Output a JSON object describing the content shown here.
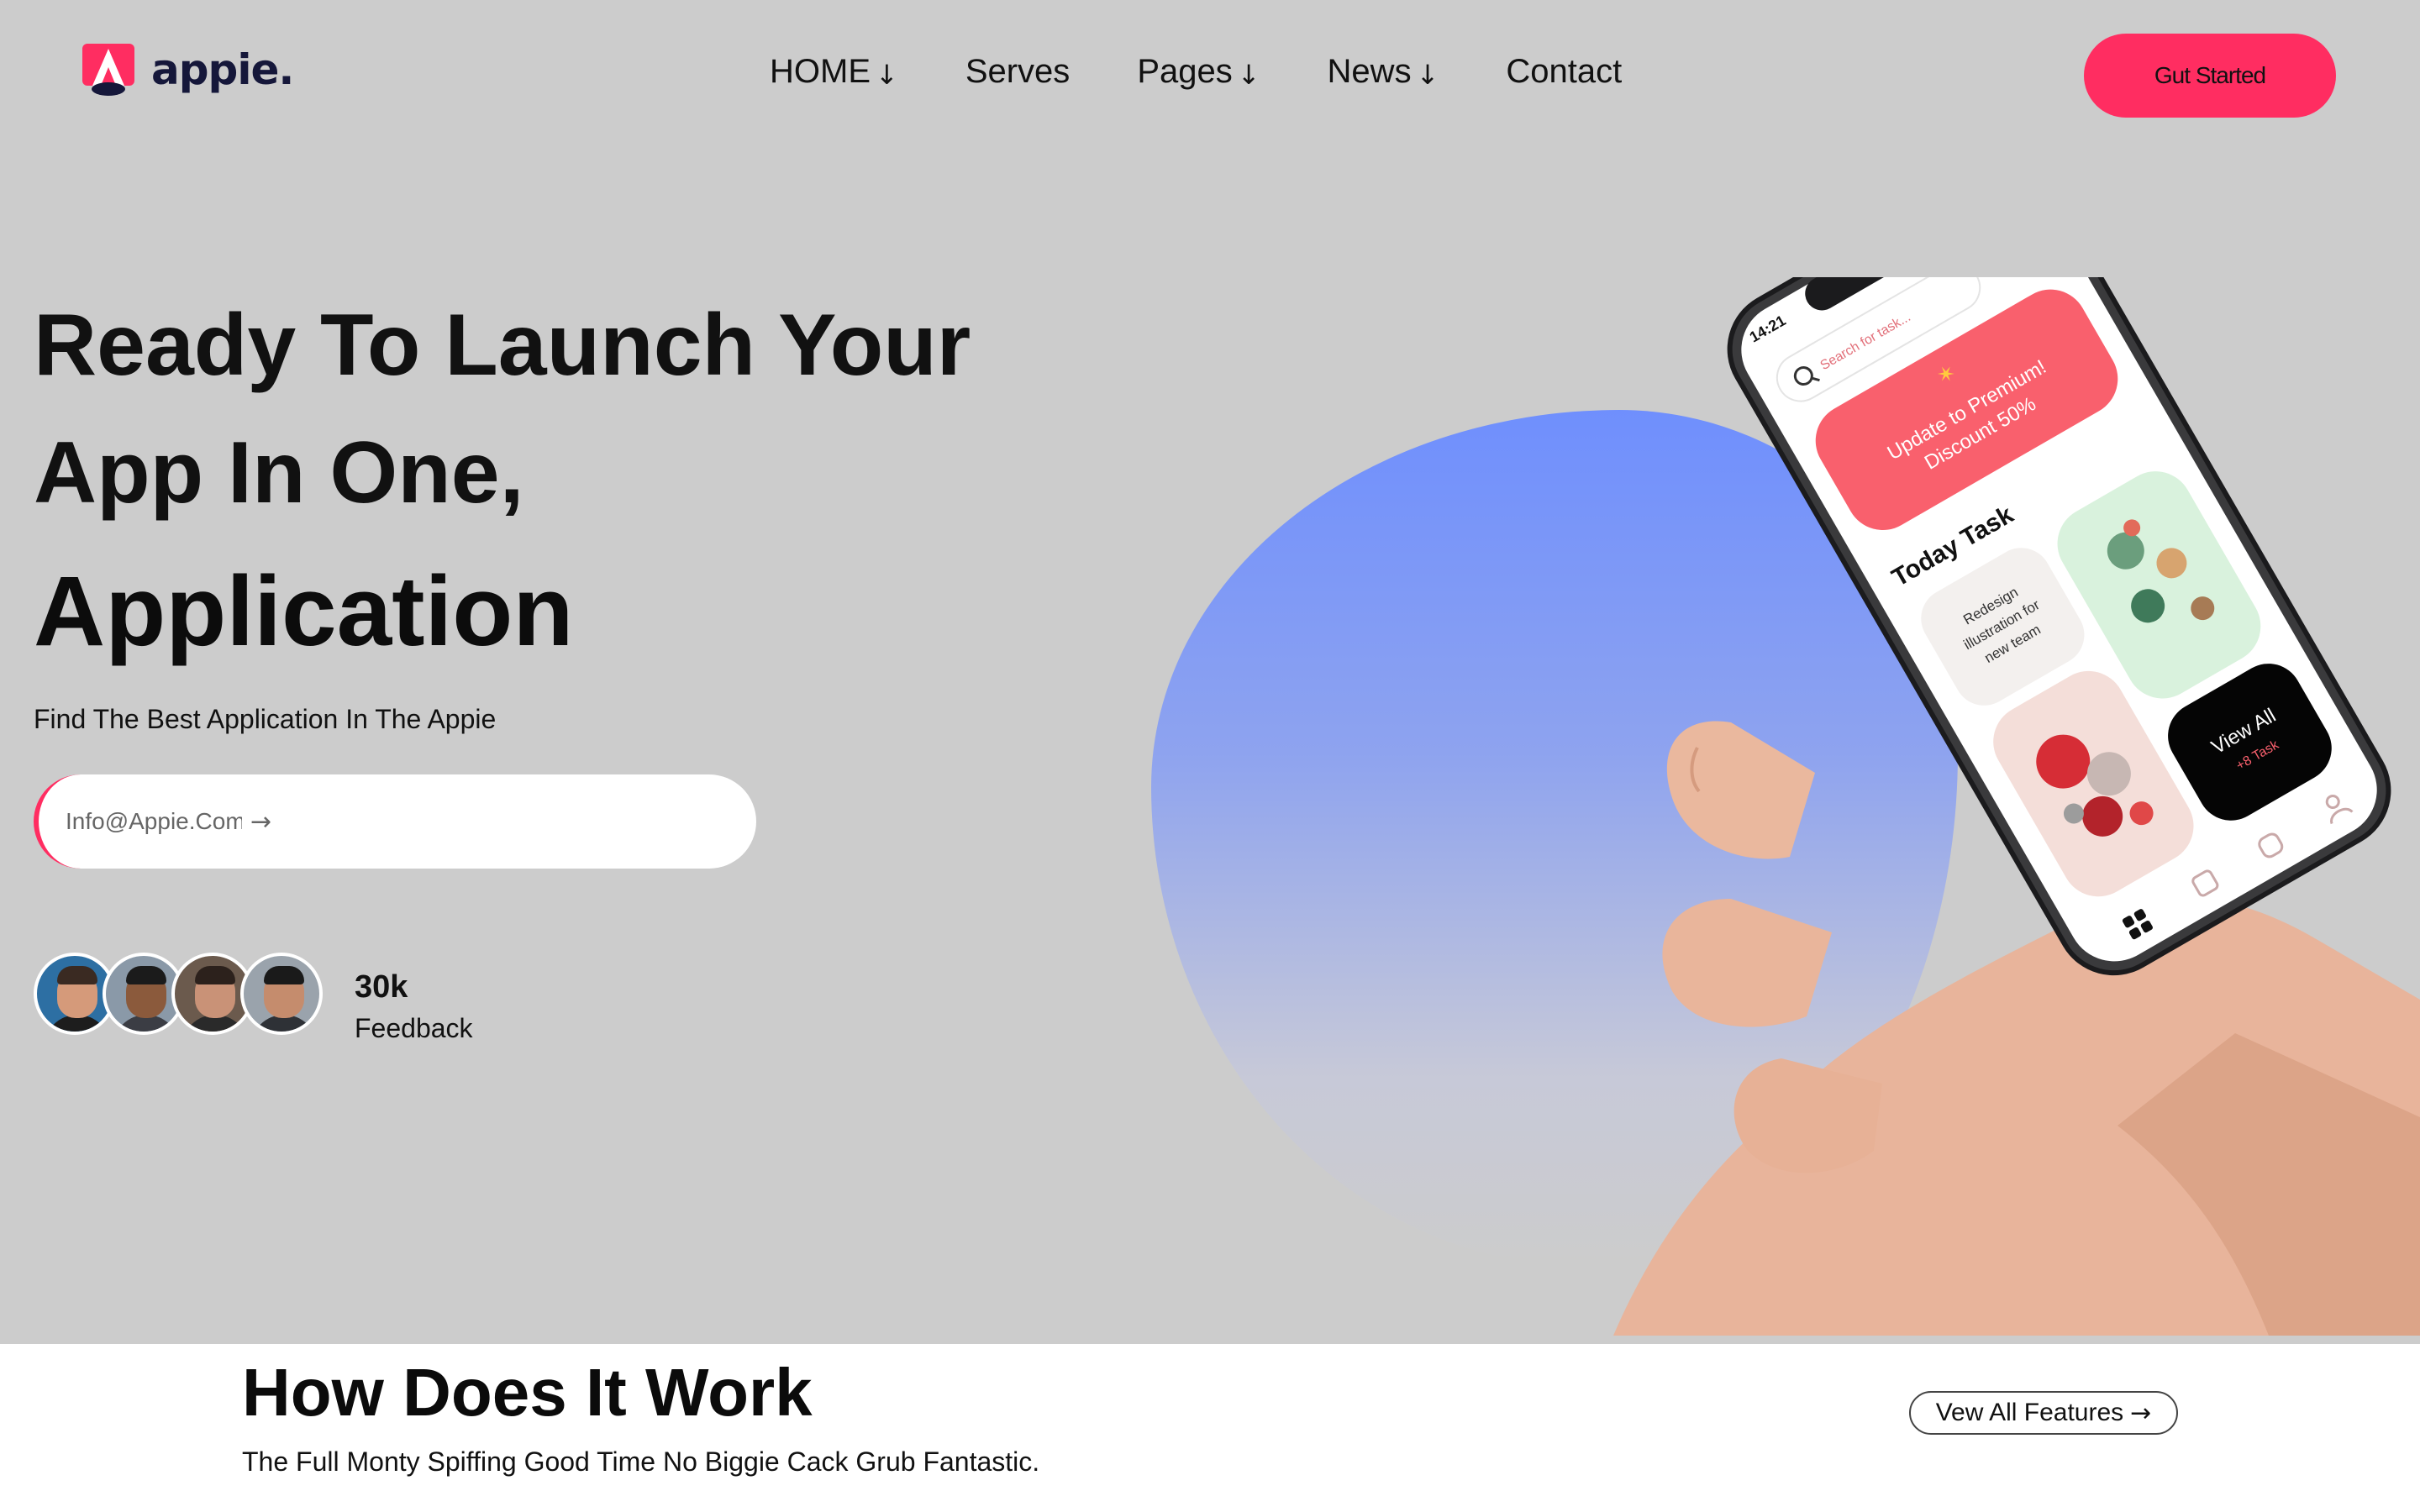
{
  "brand": {
    "name": "appie.",
    "accent": "#ff2d61",
    "navy": "#15173a"
  },
  "nav": {
    "items": [
      {
        "label": "HOME",
        "has_dropdown": true,
        "icon": "arrow-down-icon",
        "arrow": "↓"
      },
      {
        "label": "Serves",
        "has_dropdown": false
      },
      {
        "label": "Pages",
        "has_dropdown": true,
        "icon": "arrow-down-icon",
        "arrow": "↓"
      },
      {
        "label": "News",
        "has_dropdown": true,
        "icon": "arrow-down-icon",
        "arrow": "↓"
      },
      {
        "label": "Contact",
        "has_dropdown": false
      }
    ],
    "cta_label": "Gut Started"
  },
  "hero": {
    "line1": "Ready To Launch Your",
    "line2": "App In One,",
    "line3": "Application",
    "subtitle": "Find The Best Application In The Appie",
    "email_placeholder": "Info@Appie.Com",
    "email_arrow": "→",
    "feedback_count": "30k",
    "feedback_label": "Feedback",
    "blob_colors": [
      "#6f8ffd",
      "#c7c9d8"
    ]
  },
  "phone": {
    "time": "14:21",
    "search_placeholder": "Search for task...",
    "promo_line1": "Update to Premium!",
    "promo_line2": "Discount 50%",
    "section_title": "Today Task",
    "task_line1": "Redesign",
    "task_line2": "illustration for",
    "task_line3": "new team",
    "view_all": "View All",
    "task_count": "+8 Task",
    "promo_color": "#f9606d"
  },
  "features": {
    "title": "How Does It Work",
    "subtitle": "The Full Monty Spiffing Good Time No Biggie Cack Grub Fantastic.",
    "view_all_label": "Vew All Features",
    "view_all_arrow": "→"
  }
}
